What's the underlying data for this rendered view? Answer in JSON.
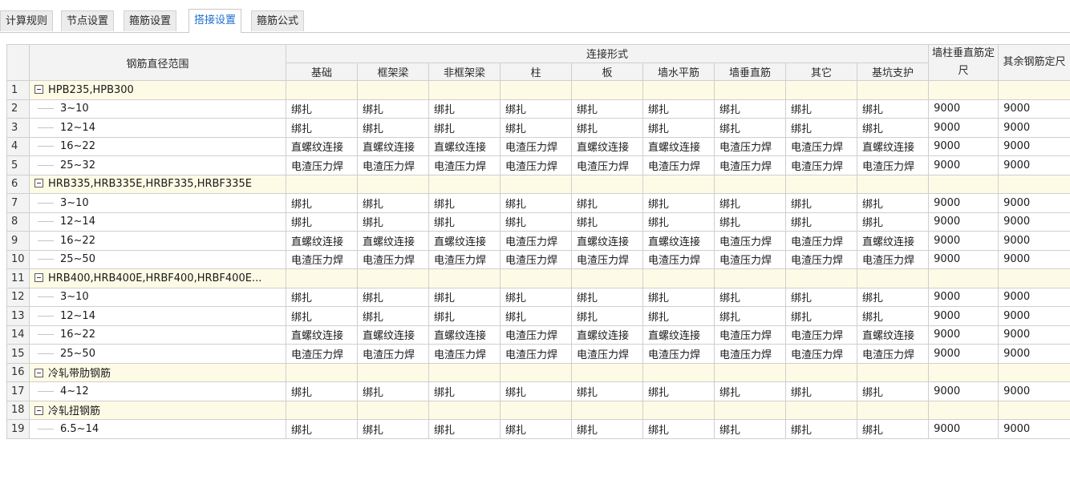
{
  "tabs": [
    {
      "label": "计算规则",
      "active": false
    },
    {
      "label": "节点设置",
      "active": false
    },
    {
      "label": "箍筋设置",
      "active": false
    },
    {
      "label": "搭接设置",
      "active": true
    },
    {
      "label": "箍筋公式",
      "active": false
    }
  ],
  "table": {
    "header_range": "钢筋直径范围",
    "header_group": "连接形式",
    "connection_columns": [
      "基础",
      "框架梁",
      "非框架梁",
      "柱",
      "板",
      "墙水平筋",
      "墙垂直筋",
      "其它",
      "基坑支护"
    ],
    "header_wall_length": "墙柱垂直筋定尺",
    "header_other_length": "其余钢筋定尺",
    "rows": [
      {
        "num": "1",
        "type": "group",
        "label": "HPB235,HPB300"
      },
      {
        "num": "2",
        "type": "item",
        "label": "3~10",
        "cells": [
          "绑扎",
          "绑扎",
          "绑扎",
          "绑扎",
          "绑扎",
          "绑扎",
          "绑扎",
          "绑扎",
          "绑扎",
          "9000",
          "9000"
        ]
      },
      {
        "num": "3",
        "type": "item",
        "label": "12~14",
        "cells": [
          "绑扎",
          "绑扎",
          "绑扎",
          "绑扎",
          "绑扎",
          "绑扎",
          "绑扎",
          "绑扎",
          "绑扎",
          "9000",
          "9000"
        ]
      },
      {
        "num": "4",
        "type": "item",
        "label": "16~22",
        "cells": [
          "直螺纹连接",
          "直螺纹连接",
          "直螺纹连接",
          "电渣压力焊",
          "直螺纹连接",
          "直螺纹连接",
          "电渣压力焊",
          "电渣压力焊",
          "直螺纹连接",
          "9000",
          "9000"
        ]
      },
      {
        "num": "5",
        "type": "item",
        "label": "25~32",
        "cells": [
          "电渣压力焊",
          "电渣压力焊",
          "电渣压力焊",
          "电渣压力焊",
          "电渣压力焊",
          "电渣压力焊",
          "电渣压力焊",
          "电渣压力焊",
          "电渣压力焊",
          "9000",
          "9000"
        ]
      },
      {
        "num": "6",
        "type": "group",
        "label": "HRB335,HRB335E,HRBF335,HRBF335E"
      },
      {
        "num": "7",
        "type": "item",
        "label": "3~10",
        "cells": [
          "绑扎",
          "绑扎",
          "绑扎",
          "绑扎",
          "绑扎",
          "绑扎",
          "绑扎",
          "绑扎",
          "绑扎",
          "9000",
          "9000"
        ]
      },
      {
        "num": "8",
        "type": "item",
        "label": "12~14",
        "cells": [
          "绑扎",
          "绑扎",
          "绑扎",
          "绑扎",
          "绑扎",
          "绑扎",
          "绑扎",
          "绑扎",
          "绑扎",
          "9000",
          "9000"
        ]
      },
      {
        "num": "9",
        "type": "item",
        "label": "16~22",
        "cells": [
          "直螺纹连接",
          "直螺纹连接",
          "直螺纹连接",
          "电渣压力焊",
          "直螺纹连接",
          "直螺纹连接",
          "电渣压力焊",
          "电渣压力焊",
          "直螺纹连接",
          "9000",
          "9000"
        ]
      },
      {
        "num": "10",
        "type": "item",
        "label": "25~50",
        "cells": [
          "电渣压力焊",
          "电渣压力焊",
          "电渣压力焊",
          "电渣压力焊",
          "电渣压力焊",
          "电渣压力焊",
          "电渣压力焊",
          "电渣压力焊",
          "电渣压力焊",
          "9000",
          "9000"
        ]
      },
      {
        "num": "11",
        "type": "group",
        "label": "HRB400,HRB400E,HRBF400,HRBF400E..."
      },
      {
        "num": "12",
        "type": "item",
        "label": "3~10",
        "cells": [
          "绑扎",
          "绑扎",
          "绑扎",
          "绑扎",
          "绑扎",
          "绑扎",
          "绑扎",
          "绑扎",
          "绑扎",
          "9000",
          "9000"
        ]
      },
      {
        "num": "13",
        "type": "item",
        "label": "12~14",
        "cells": [
          "绑扎",
          "绑扎",
          "绑扎",
          "绑扎",
          "绑扎",
          "绑扎",
          "绑扎",
          "绑扎",
          "绑扎",
          "9000",
          "9000"
        ]
      },
      {
        "num": "14",
        "type": "item",
        "label": "16~22",
        "cells": [
          "直螺纹连接",
          "直螺纹连接",
          "直螺纹连接",
          "电渣压力焊",
          "直螺纹连接",
          "直螺纹连接",
          "电渣压力焊",
          "电渣压力焊",
          "直螺纹连接",
          "9000",
          "9000"
        ]
      },
      {
        "num": "15",
        "type": "item",
        "label": "25~50",
        "cells": [
          "电渣压力焊",
          "电渣压力焊",
          "电渣压力焊",
          "电渣压力焊",
          "电渣压力焊",
          "电渣压力焊",
          "电渣压力焊",
          "电渣压力焊",
          "电渣压力焊",
          "9000",
          "9000"
        ]
      },
      {
        "num": "16",
        "type": "group",
        "label": "冷轧带肋钢筋"
      },
      {
        "num": "17",
        "type": "item",
        "label": "4~12",
        "cells": [
          "绑扎",
          "绑扎",
          "绑扎",
          "绑扎",
          "绑扎",
          "绑扎",
          "绑扎",
          "绑扎",
          "绑扎",
          "9000",
          "9000"
        ]
      },
      {
        "num": "18",
        "type": "group",
        "label": "冷轧扭钢筋"
      },
      {
        "num": "19",
        "type": "item",
        "label": "6.5~14",
        "cells": [
          "绑扎",
          "绑扎",
          "绑扎",
          "绑扎",
          "绑扎",
          "绑扎",
          "绑扎",
          "绑扎",
          "绑扎",
          "9000",
          "9000"
        ]
      }
    ]
  },
  "colors": {
    "tab_active_text": "#1f6fd1",
    "group_row_bg": "#fdfbe5",
    "header_bg": "#f3f3f3",
    "grid_line": "#cfcfcf"
  }
}
